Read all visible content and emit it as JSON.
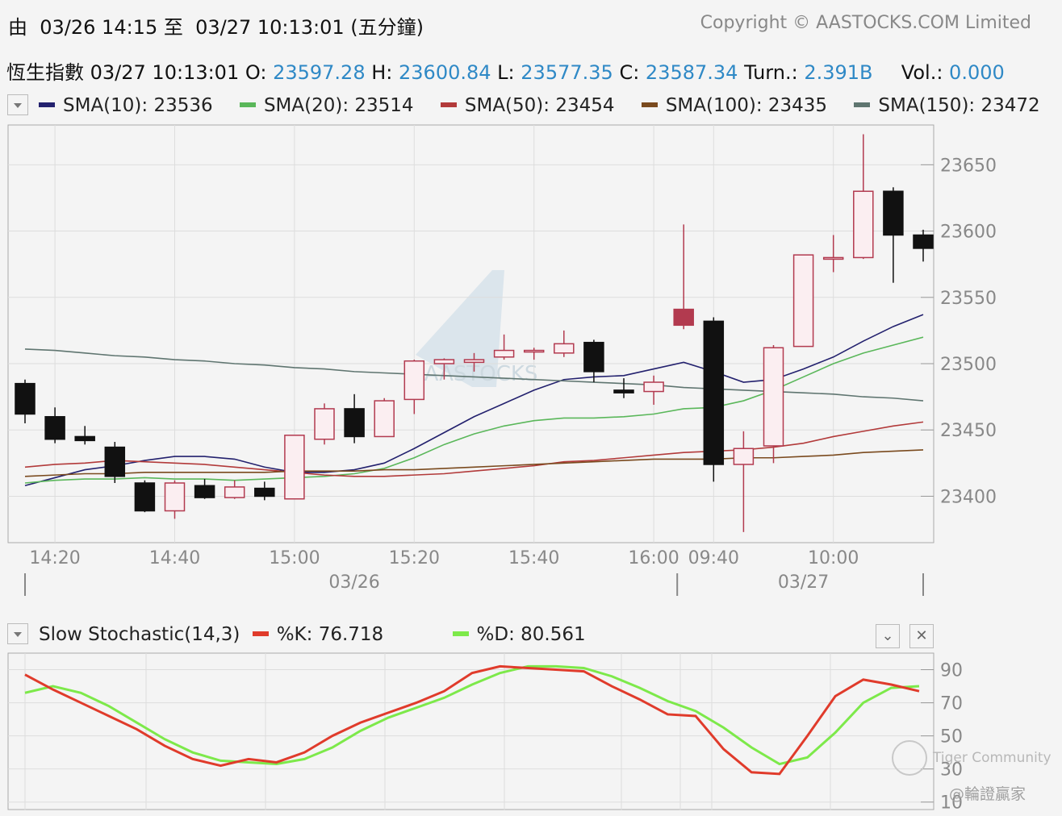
{
  "header": {
    "range_text": "由  03/26 14:15 至  03/27 10:13:01 (五分鐘)",
    "copyright": "Copyright © AASTOCKS.COM Limited"
  },
  "quote": {
    "name": "恆生指數",
    "time": "03/27 10:13:01",
    "o_label": "O:",
    "o": "23597.28",
    "h_label": "H:",
    "h": "23600.84",
    "l_label": "L:",
    "l": "23577.35",
    "c_label": "C:",
    "c": "23587.34",
    "turn_label": "Turn.:",
    "turn": "2.391B",
    "vol_label": "Vol.:",
    "vol": "0.000"
  },
  "sma_legend": [
    {
      "label": "SMA(10): 23536",
      "color": "#23216e"
    },
    {
      "label": "SMA(20): 23514",
      "color": "#5ab75a"
    },
    {
      "label": "SMA(50): 23454",
      "color": "#b23a3a"
    },
    {
      "label": "SMA(100): 23435",
      "color": "#7a4a1e"
    },
    {
      "label": "SMA(150): 23472",
      "color": "#5f7570"
    }
  ],
  "stoch_legend": {
    "title": "Slow Stochastic(14,3)",
    "k_label": "%K: 76.718",
    "k_color": "#e03b2b",
    "d_label": "%D: 80.561",
    "d_color": "#7de94a"
  },
  "close_glyph": "✕",
  "chevron_glyph": "⌄",
  "watermarks": {
    "center": "AASTOCKS",
    "community": "Tiger Community",
    "user": "@輪證贏家"
  },
  "colors": {
    "up": "#b23a4f",
    "down": "#111111",
    "value": "#2f89c6"
  },
  "chart_data": [
    {
      "type": "candlestick",
      "title": "恆生指數",
      "ylim": [
        23365,
        23680
      ],
      "yticks": [
        23400,
        23450,
        23500,
        23550,
        23600,
        23650
      ],
      "x_tick_labels": [
        "14:20",
        "14:40",
        "15:00",
        "15:20",
        "15:40",
        "16:00",
        "09:40",
        "10:00"
      ],
      "x_date_labels": [
        "03/26",
        "03/27"
      ],
      "candles": [
        {
          "o": 23485,
          "h": 23488,
          "l": 23455,
          "c": 23462
        },
        {
          "o": 23460,
          "h": 23467,
          "l": 23440,
          "c": 23443
        },
        {
          "o": 23445,
          "h": 23453,
          "l": 23439,
          "c": 23442
        },
        {
          "o": 23437,
          "h": 23441,
          "l": 23410,
          "c": 23415
        },
        {
          "o": 23410,
          "h": 23412,
          "l": 23388,
          "c": 23389
        },
        {
          "o": 23389,
          "h": 23412,
          "l": 23383,
          "c": 23410
        },
        {
          "o": 23408,
          "h": 23413,
          "l": 23398,
          "c": 23399
        },
        {
          "o": 23399,
          "h": 23412,
          "l": 23398,
          "c": 23407
        },
        {
          "o": 23406,
          "h": 23411,
          "l": 23397,
          "c": 23400
        },
        {
          "o": 23398,
          "h": 23446,
          "l": 23398,
          "c": 23446
        },
        {
          "o": 23443,
          "h": 23470,
          "l": 23439,
          "c": 23466
        },
        {
          "o": 23466,
          "h": 23477,
          "l": 23440,
          "c": 23445
        },
        {
          "o": 23445,
          "h": 23474,
          "l": 23445,
          "c": 23472
        },
        {
          "o": 23473,
          "h": 23503,
          "l": 23462,
          "c": 23502
        },
        {
          "o": 23500,
          "h": 23504,
          "l": 23488,
          "c": 23503
        },
        {
          "o": 23501,
          "h": 23508,
          "l": 23494,
          "c": 23503
        },
        {
          "o": 23505,
          "h": 23522,
          "l": 23503,
          "c": 23510
        },
        {
          "o": 23509,
          "h": 23512,
          "l": 23503,
          "c": 23510
        },
        {
          "o": 23508,
          "h": 23525,
          "l": 23505,
          "c": 23515
        },
        {
          "o": 23516,
          "h": 23518,
          "l": 23486,
          "c": 23494
        },
        {
          "o": 23480,
          "h": 23489,
          "l": 23474,
          "c": 23478
        },
        {
          "o": 23479,
          "h": 23491,
          "l": 23469,
          "c": 23486
        },
        {
          "o": 23529,
          "h": 23605,
          "l": 23526,
          "c": 23541
        },
        {
          "o": 23532,
          "h": 23535,
          "l": 23411,
          "c": 23424
        },
        {
          "o": 23424,
          "h": 23449,
          "l": 23373,
          "c": 23436
        },
        {
          "o": 23438,
          "h": 23514,
          "l": 23425,
          "c": 23512
        },
        {
          "o": 23513,
          "h": 23582,
          "l": 23513,
          "c": 23582
        },
        {
          "o": 23580,
          "h": 23597,
          "l": 23569,
          "c": 23580
        },
        {
          "o": 23580,
          "h": 23673,
          "l": 23579,
          "c": 23630
        },
        {
          "o": 23630,
          "h": 23633,
          "l": 23561,
          "c": 23597
        },
        {
          "o": 23597,
          "h": 23601,
          "l": 23577,
          "c": 23587
        }
      ],
      "sma": [
        {
          "name": "SMA(10)",
          "values": [
            23408,
            23414,
            23420,
            23423,
            23427,
            23430,
            23430,
            23428,
            23422,
            23418,
            23418,
            23420,
            23425,
            23436,
            23448,
            23460,
            23470,
            23480,
            23488,
            23490,
            23491,
            23496,
            23501,
            23494,
            23486,
            23488,
            23496,
            23505,
            23517,
            23528,
            23537
          ]
        },
        {
          "name": "SMA(20)",
          "values": [
            23410,
            23412,
            23413,
            23413,
            23414,
            23413,
            23413,
            23412,
            23413,
            23414,
            23415,
            23417,
            23421,
            23429,
            23439,
            23447,
            23453,
            23457,
            23459,
            23459,
            23460,
            23462,
            23466,
            23467,
            23472,
            23480,
            23490,
            23500,
            23508,
            23514,
            23520
          ]
        },
        {
          "name": "SMA(50)",
          "values": [
            23422,
            23424,
            23425,
            23427,
            23426,
            23425,
            23424,
            23422,
            23420,
            23418,
            23416,
            23415,
            23415,
            23416,
            23417,
            23419,
            23421,
            23423,
            23426,
            23427,
            23429,
            23431,
            23433,
            23434,
            23435,
            23437,
            23440,
            23445,
            23449,
            23453,
            23456
          ]
        },
        {
          "name": "SMA(100)",
          "values": [
            23415,
            23416,
            23417,
            23417,
            23418,
            23418,
            23418,
            23418,
            23418,
            23419,
            23419,
            23419,
            23420,
            23420,
            23421,
            23422,
            23423,
            23424,
            23425,
            23426,
            23427,
            23428,
            23428,
            23428,
            23429,
            23429,
            23430,
            23431,
            23433,
            23434,
            23435
          ]
        },
        {
          "name": "SMA(150)",
          "values": [
            23511,
            23510,
            23508,
            23506,
            23505,
            23503,
            23502,
            23500,
            23499,
            23497,
            23496,
            23494,
            23493,
            23492,
            23491,
            23490,
            23489,
            23488,
            23487,
            23486,
            23485,
            23484,
            23482,
            23481,
            23480,
            23479,
            23478,
            23477,
            23475,
            23474,
            23472
          ]
        }
      ]
    },
    {
      "type": "line",
      "title": "Slow Stochastic(14,3)",
      "ylim": [
        5,
        100
      ],
      "yticks": [
        10,
        30,
        50,
        70,
        90
      ],
      "series": [
        {
          "name": "%K",
          "values": [
            87,
            78,
            70,
            62,
            54,
            44,
            36,
            32,
            36,
            34,
            40,
            50,
            58,
            64,
            70,
            77,
            88,
            92,
            91,
            90,
            89,
            80,
            72,
            63,
            62,
            42,
            28,
            27,
            50,
            74,
            84,
            81,
            77
          ]
        },
        {
          "name": "%D",
          "values": [
            76,
            80,
            76,
            68,
            58,
            48,
            40,
            35,
            34,
            33,
            36,
            43,
            53,
            61,
            67,
            73,
            81,
            88,
            92,
            92,
            91,
            86,
            79,
            71,
            65,
            55,
            43,
            33,
            37,
            52,
            70,
            79,
            80
          ]
        }
      ]
    }
  ]
}
